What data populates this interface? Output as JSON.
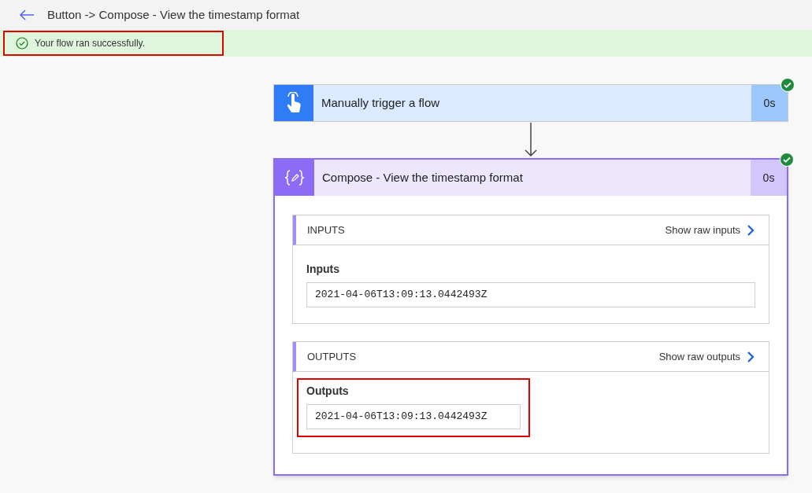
{
  "header": {
    "title": "Button -> Compose - View the timestamp format"
  },
  "banner": {
    "message": "Your flow ran successfully.",
    "highlighted": true
  },
  "steps": [
    {
      "kind": "trigger",
      "title": "Manually trigger a flow",
      "duration": "0s",
      "succeeded": true
    },
    {
      "kind": "action",
      "title": "Compose - View the timestamp format",
      "duration": "0s",
      "succeeded": true,
      "sections": [
        {
          "heading": "INPUTS",
          "link": "Show raw inputs",
          "label": "Inputs",
          "value": "2021-04-06T13:09:13.0442493Z",
          "highlighted": false
        },
        {
          "heading": "OUTPUTS",
          "link": "Show raw outputs",
          "label": "Outputs",
          "value": "2021-04-06T13:09:13.0442493Z",
          "highlighted": true
        }
      ]
    }
  ]
}
